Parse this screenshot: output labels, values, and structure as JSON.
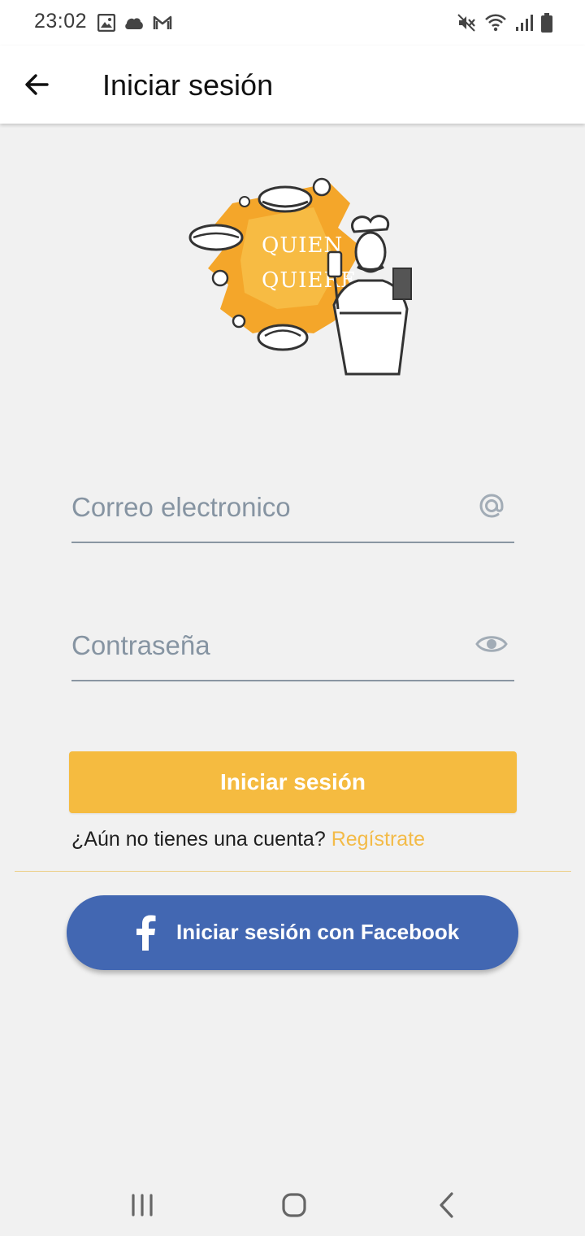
{
  "status_bar": {
    "time": "23:02",
    "left_icons": [
      "image-icon",
      "cloud-icon",
      "gmail-icon"
    ],
    "right_icons": [
      "mute-icon",
      "wifi-icon",
      "signal-icon",
      "battery-icon"
    ]
  },
  "app_bar": {
    "title": "Iniciar sesión",
    "back_icon": "arrow-back-icon"
  },
  "logo": {
    "line1": "QUIEN",
    "line2": "QUIERE"
  },
  "form": {
    "email_placeholder": "Correo electronico",
    "email_value": "",
    "email_icon": "at-icon",
    "password_placeholder": "Contraseña",
    "password_value": "",
    "password_icon": "eye-icon"
  },
  "actions": {
    "login_label": "Iniciar sesión",
    "no_account_text": "¿Aún no tienes una cuenta?",
    "register_label": "Regístrate",
    "facebook_label": "Iniciar sesión con Facebook"
  },
  "colors": {
    "accent": "#f5bb40",
    "facebook": "#4267b2",
    "background": "#f1f1f1"
  },
  "nav_bar": {
    "icons": [
      "recent-apps-icon",
      "home-icon",
      "nav-back-icon"
    ]
  }
}
